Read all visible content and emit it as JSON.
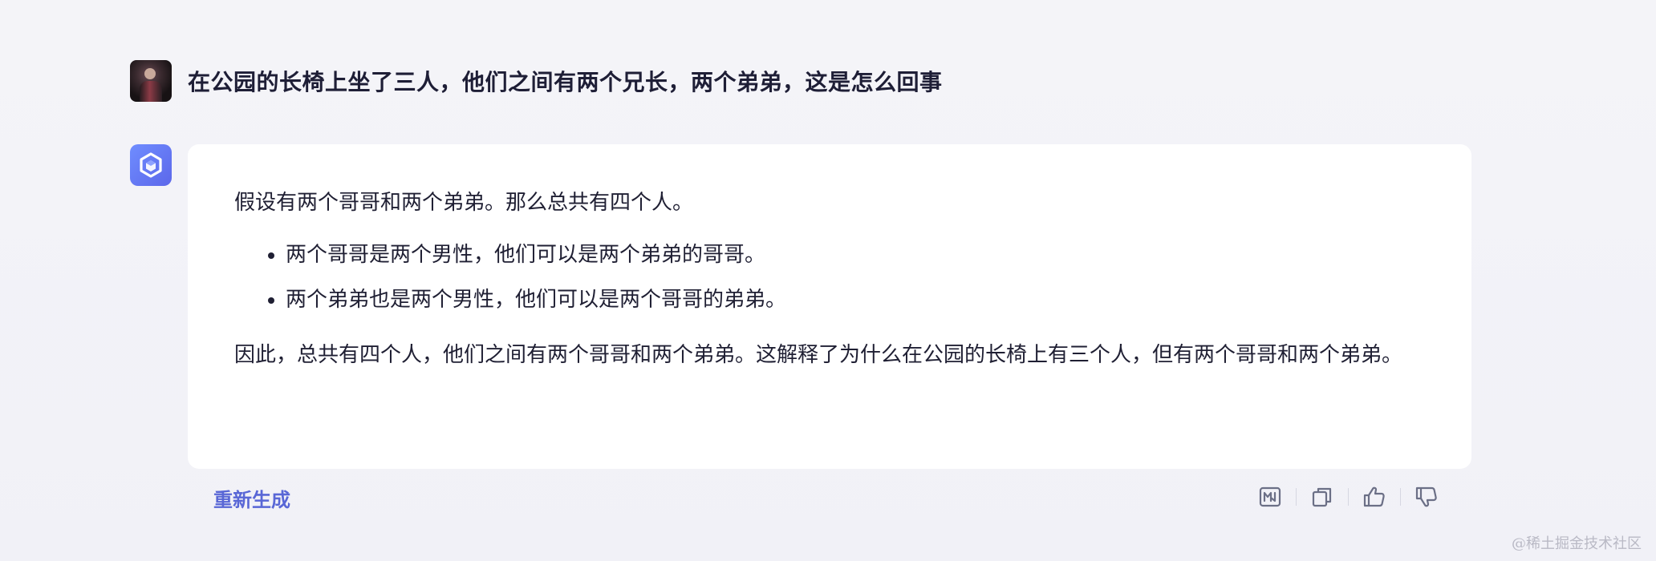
{
  "question": {
    "text": "在公园的长椅上坐了三人，他们之间有两个兄长，两个弟弟，这是怎么回事"
  },
  "answer": {
    "intro": "假设有两个哥哥和两个弟弟。那么总共有四个人。",
    "bullets": [
      "两个哥哥是两个男性，他们可以是两个弟弟的哥哥。",
      "两个弟弟也是两个男性，他们可以是两个哥哥的弟弟。"
    ],
    "conclusion": "因此，总共有四个人，他们之间有两个哥哥和两个弟弟。这解释了为什么在公园的长椅上有三个人，但有两个哥哥和两个弟弟。"
  },
  "actions": {
    "regenerate_label": "重新生成",
    "icons": [
      "markdown-icon",
      "copy-icon",
      "thumbs-up-icon",
      "thumbs-down-icon"
    ]
  },
  "watermark": {
    "text": "@稀土掘金技术社区"
  },
  "colors": {
    "accent": "#5967d6",
    "bot_avatar": "#6378f0",
    "background": "#f3f3f8"
  }
}
